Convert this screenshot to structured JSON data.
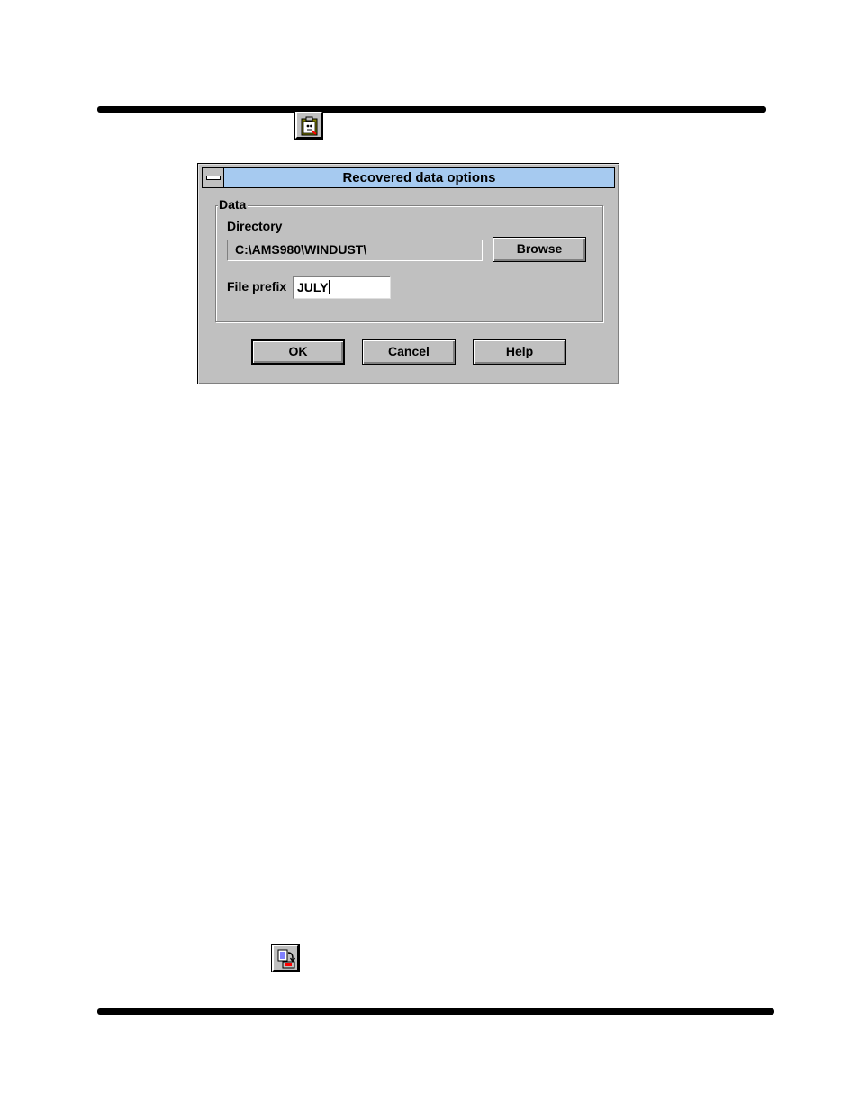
{
  "dialog": {
    "title": "Recovered data options",
    "group_label": "Data",
    "directory_label": "Directory",
    "directory_value": "C:\\AMS980\\WINDUST\\",
    "browse_label": "Browse",
    "file_prefix_label": "File prefix",
    "file_prefix_value": "JULY",
    "ok_label": "OK",
    "cancel_label": "Cancel",
    "help_label": "Help"
  },
  "icons": {
    "top": "clipboard-options-icon",
    "bottom": "document-transfer-icon"
  },
  "colors": {
    "titlebar": "#a6caf0",
    "face": "#c0c0c0"
  }
}
